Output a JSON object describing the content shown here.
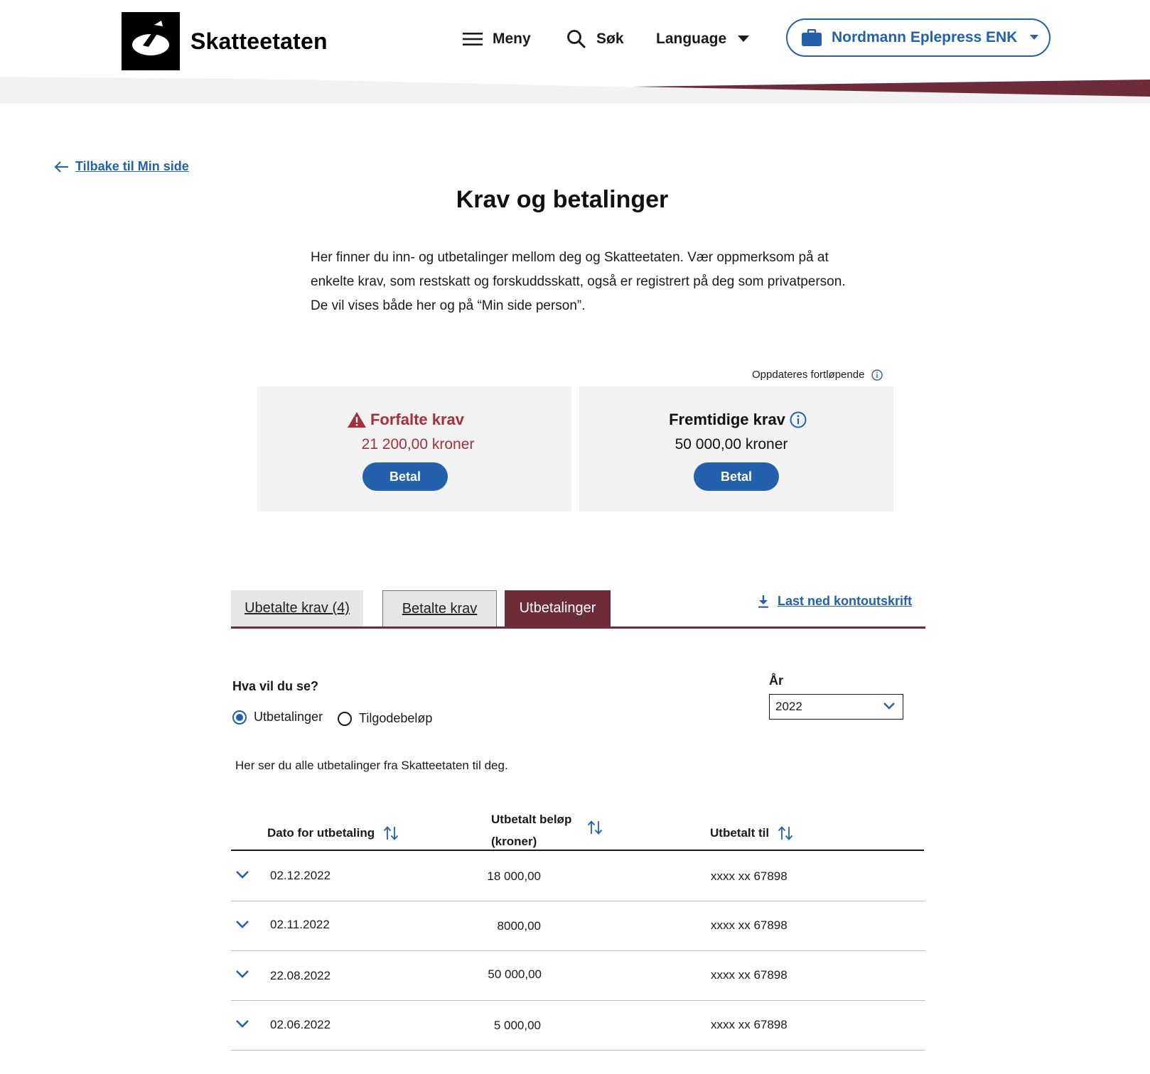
{
  "header": {
    "brand": "Skatteetaten",
    "menu_label": "Meny",
    "search_label": "Søk",
    "language_label": "Language",
    "org_label": "Nordmann Eplepress ENK",
    "accent_color": "#6e2b3a"
  },
  "back_link": "Tilbake til Min side",
  "page_title": "Krav og betalinger",
  "intro": "Her finner du inn- og utbetalinger mellom deg og Skatteetaten. Vær oppmerksom på at enkelte krav, som restskatt og forskuddsskatt, også er registrert på deg som privatperson. De vil vises både her og på “Min side person”.",
  "updated_text": "Oppdateres fortløpende",
  "cards": {
    "overdue": {
      "title": "Forfalte krav",
      "amount": "21 200,00 kroner",
      "button": "Betal"
    },
    "future": {
      "title": "Fremtidige krav",
      "amount": "50 000,00 kroner",
      "button": "Betal"
    }
  },
  "tabs": [
    {
      "label": "Ubetalte krav (4)"
    },
    {
      "label": "Betalte krav"
    },
    {
      "label": "Utbetalinger"
    }
  ],
  "download_label": "Last ned kontoutskrift",
  "filter": {
    "question": "Hva vil du se?",
    "options": [
      "Utbetalinger",
      "Tilgodebeløp"
    ],
    "selected": "Utbetalinger",
    "year_label": "År",
    "year_value": "2022"
  },
  "description": "Her ser du alle utbetalinger fra Skatteetaten til deg.",
  "table": {
    "headers": {
      "date": "Dato for utbetaling",
      "amount_line1": "Utbetalt beløp",
      "amount_line2": "(kroner)",
      "to": "Utbetalt til"
    },
    "rows": [
      {
        "date": "02.12.2022",
        "amount": "18 000,00",
        "to": "xxxx xx 67898"
      },
      {
        "date": "02.11.2022",
        "amount": "8000,00",
        "to": "xxxx xx 67898"
      },
      {
        "date": "22.08.2022",
        "amount": "50 000,00",
        "to": "xxxx xx 67898"
      },
      {
        "date": "02.06.2022",
        "amount": "5 000,00",
        "to": "xxxx xx 67898"
      }
    ]
  }
}
